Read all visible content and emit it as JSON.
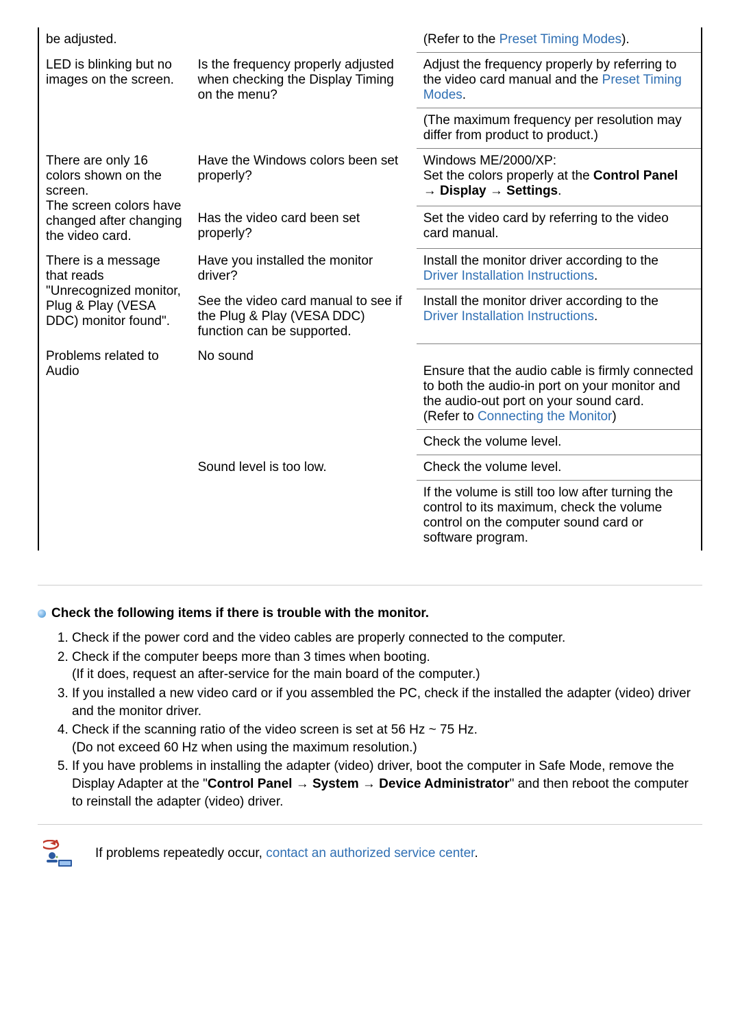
{
  "rows": [
    {
      "c1": "be adjusted.",
      "c2": "",
      "c3": "(Refer to the ",
      "link": "Preset Timing Modes",
      "after": ")."
    },
    {
      "c1": "LED is blinking but no images on the screen.",
      "c2": "Is the frequency properly adjusted when checking the Display Timing on the menu?",
      "c3": "Adjust the frequency properly by referring to the video card manual and the ",
      "link": "Preset Timing Modes",
      "after": "."
    },
    {
      "c3": "(The maximum frequency per resolution may differ from product to product.)"
    },
    {
      "c1": "There are only 16 colors shown on the screen.\nThe screen colors have changed after changing the video card.",
      "c2": "Have the Windows colors been set properly?",
      "c3_html": "Windows ME/2000/XP:<br>Set the colors properly at the <b>Control Panel <span class='arrow'>→</span> Display <span class='arrow'>→</span> Settings</b>."
    },
    {
      "c2": "Has the video card been set properly?",
      "c3": "Set the video card by referring to the video card manual."
    },
    {
      "c1": "There is a message that reads \"Unrecognized monitor, Plug & Play (VESA DDC) monitor found\".",
      "c2": "Have you installed the monitor driver?",
      "c3": "Install the monitor driver according to the ",
      "link": "Driver Installation Instructions",
      "after": "."
    },
    {
      "c2": "See the video card manual to see if the Plug & Play (VESA DDC) function can be supported.",
      "c3": "Install the monitor driver according to the ",
      "link": "Driver Installation Instructions",
      "after": "."
    },
    {
      "c1": "Problems related to Audio",
      "c2": "No sound",
      "c3": "Ensure that the audio cable is firmly connected to both the audio-in port on your monitor and the audio-out port on your sound card.\n(Refer to ",
      "link": "Connecting the Monitor",
      "after": ")"
    },
    {
      "c3": "Check the volume level."
    },
    {
      "c2": "Sound level is too low.",
      "c3": "Check the volume level."
    },
    {
      "c3": "If the volume is still too low after turning the control to its maximum, check the volume control on the computer sound card or software program."
    }
  ],
  "section_title": "Check the following items if there is trouble with the monitor.",
  "checks": [
    "Check if the power cord and the video cables are properly connected to the computer.",
    "Check if the computer beeps more than 3 times when booting.\n(If it does, request an after-service for the main board of the computer.)",
    "If you installed a new video card or if you assembled the PC, check if the installed the adapter (video) driver and the monitor driver.",
    "Check if the scanning ratio of the video screen is set at 56 Hz ~ 75 Hz.\n(Do not exceed 60 Hz when using the maximum resolution.)",
    "If you have problems in installing the adapter (video) driver, boot the computer in Safe Mode, remove the Display Adapter at the \"<b>Control Panel <span class='arrow'>→</span> System <span class='arrow'>→</span> Device Administrator</b>\" and then reboot the computer to reinstall the adapter (video) driver."
  ],
  "note_prefix": "If problems repeatedly occur, ",
  "note_link": "contact an authorized service center",
  "note_after": "."
}
